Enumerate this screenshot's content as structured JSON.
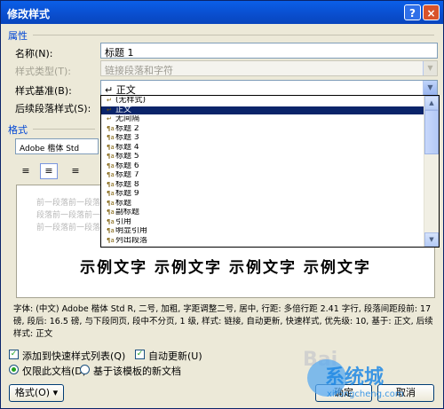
{
  "window": {
    "title": "修改样式",
    "help_label": "?",
    "close_label": "×"
  },
  "properties": {
    "group_label": "属性",
    "name_label": "名称(N):",
    "name_value": "标题 1",
    "style_type_label": "样式类型(T):",
    "style_type_value": "链接段落和字符",
    "based_on_label": "样式基准(B):",
    "based_on_value": "↵ 正文",
    "following_label": "后续段落样式(S):",
    "following_value": "↵ 正文"
  },
  "dropdown_items": [
    "(无样式)",
    "正文",
    "无间隔",
    "标题 2",
    "标题 3",
    "标题 4",
    "标题 5",
    "标题 6",
    "标题 7",
    "标题 8",
    "标题 9",
    "标题",
    "副标题",
    "引用",
    "明显引用",
    "列出段落"
  ],
  "dropdown_selected": 1,
  "format": {
    "group_label": "格式",
    "font_value": "Adobe 楷体 Std",
    "align_left": "≡",
    "align_center": "≡",
    "align_right": "≡"
  },
  "preview": {
    "prev_lines": [
      "前一段落前一段落前一段落前一段落前一段落前一段落前一段落前一段落前一段落前一段落",
      "段落前一段落前一段落前一段落前一段落前一段落前一段落前一段落前一段落前一段落前一段",
      "前一段落前一段落前一段落前一段落前一段落前一段落前一段落前一段落前一段落"
    ],
    "sample_text": "示例文字 示例文字 示例文字 示例文字"
  },
  "description": "字体: (中文) Adobe 楷体 Std R, 二号, 加粗, 字距调整二号, 居中, 行距: 多倍行距 2.41 字行, 段落间距段前: 17 磅, 段后: 16.5 磅, 与下段同页, 段中不分页, 1 级, 样式: 链接, 自动更新, 快速样式, 优先级: 10, 基于: 正文, 后续样式: 正文",
  "options": {
    "add_quick_style": "添加到快速样式列表(Q)",
    "auto_update": "自动更新(U)",
    "only_this_doc": "仅限此文档(D)",
    "new_docs_template": "基于该模板的新文档"
  },
  "buttons": {
    "format": "格式(O) ▾",
    "ok": "确定",
    "cancel": "取消"
  },
  "watermark": {
    "brand": "系统城",
    "url": "xitongcheng.com",
    "baidu": "Bai"
  }
}
